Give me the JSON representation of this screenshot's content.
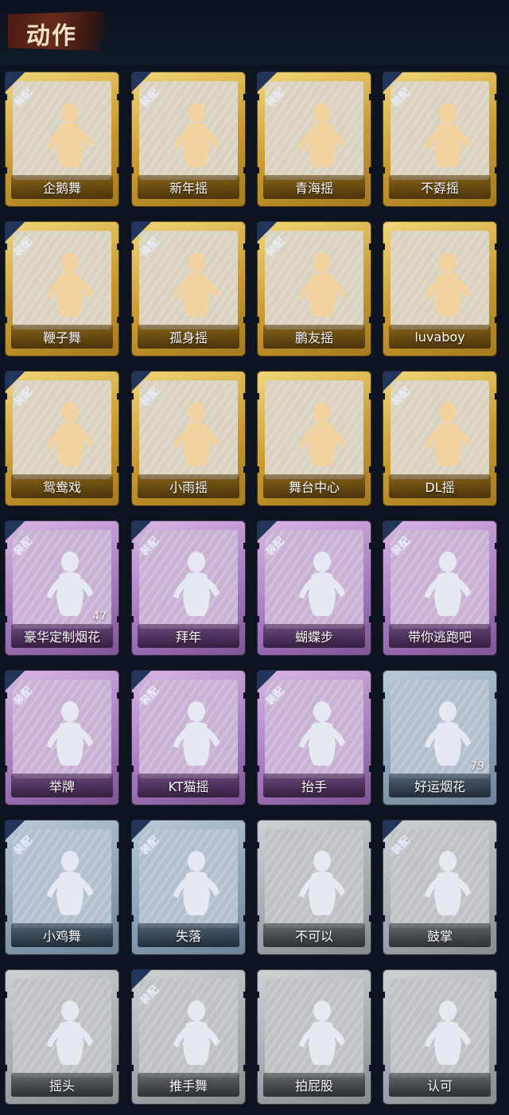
{
  "header": {
    "title": "动作"
  },
  "badge_label": "装配",
  "colors": {
    "gold": "#d4a53a",
    "purple": "#b48acb",
    "blue": "#97abbd",
    "grey": "#aeb1b5",
    "figure_gold": "#f2d3a0",
    "figure_light": "#e6e9ef"
  },
  "items": [
    {
      "name": "企鹅舞",
      "tier": "gold",
      "equipped": true,
      "count": ""
    },
    {
      "name": "新年摇",
      "tier": "gold",
      "equipped": true,
      "count": ""
    },
    {
      "name": "青海摇",
      "tier": "gold",
      "equipped": true,
      "count": ""
    },
    {
      "name": "不孬摇",
      "tier": "gold",
      "equipped": true,
      "count": ""
    },
    {
      "name": "鞭子舞",
      "tier": "gold",
      "equipped": true,
      "count": ""
    },
    {
      "name": "孤身摇",
      "tier": "gold",
      "equipped": true,
      "count": ""
    },
    {
      "name": "鹏友摇",
      "tier": "gold",
      "equipped": true,
      "count": ""
    },
    {
      "name": "luvaboy",
      "tier": "gold",
      "equipped": false,
      "count": ""
    },
    {
      "name": "鸳鸯戏",
      "tier": "gold",
      "equipped": true,
      "count": ""
    },
    {
      "name": "小雨摇",
      "tier": "gold",
      "equipped": true,
      "count": ""
    },
    {
      "name": "舞台中心",
      "tier": "gold",
      "equipped": false,
      "count": ""
    },
    {
      "name": "DL摇",
      "tier": "gold",
      "equipped": true,
      "count": ""
    },
    {
      "name": "豪华定制烟花",
      "tier": "purple",
      "equipped": true,
      "count": "47"
    },
    {
      "name": "拜年",
      "tier": "purple",
      "equipped": true,
      "count": ""
    },
    {
      "name": "蝴蝶步",
      "tier": "purple",
      "equipped": true,
      "count": ""
    },
    {
      "name": "带你逃跑吧",
      "tier": "purple",
      "equipped": true,
      "count": ""
    },
    {
      "name": "举牌",
      "tier": "purple",
      "equipped": true,
      "count": ""
    },
    {
      "name": "KT猫摇",
      "tier": "purple",
      "equipped": true,
      "count": ""
    },
    {
      "name": "抬手",
      "tier": "purple",
      "equipped": true,
      "count": ""
    },
    {
      "name": "好运烟花",
      "tier": "blue",
      "equipped": false,
      "count": "79"
    },
    {
      "name": "小鸡舞",
      "tier": "blue",
      "equipped": true,
      "count": ""
    },
    {
      "name": "失落",
      "tier": "blue",
      "equipped": true,
      "count": ""
    },
    {
      "name": "不可以",
      "tier": "grey",
      "equipped": false,
      "count": ""
    },
    {
      "name": "鼓掌",
      "tier": "grey",
      "equipped": true,
      "count": ""
    },
    {
      "name": "摇头",
      "tier": "grey",
      "equipped": false,
      "count": ""
    },
    {
      "name": "推手舞",
      "tier": "grey",
      "equipped": true,
      "count": ""
    },
    {
      "name": "拍屁股",
      "tier": "grey",
      "equipped": false,
      "count": ""
    },
    {
      "name": "认可",
      "tier": "grey",
      "equipped": false,
      "count": ""
    }
  ]
}
